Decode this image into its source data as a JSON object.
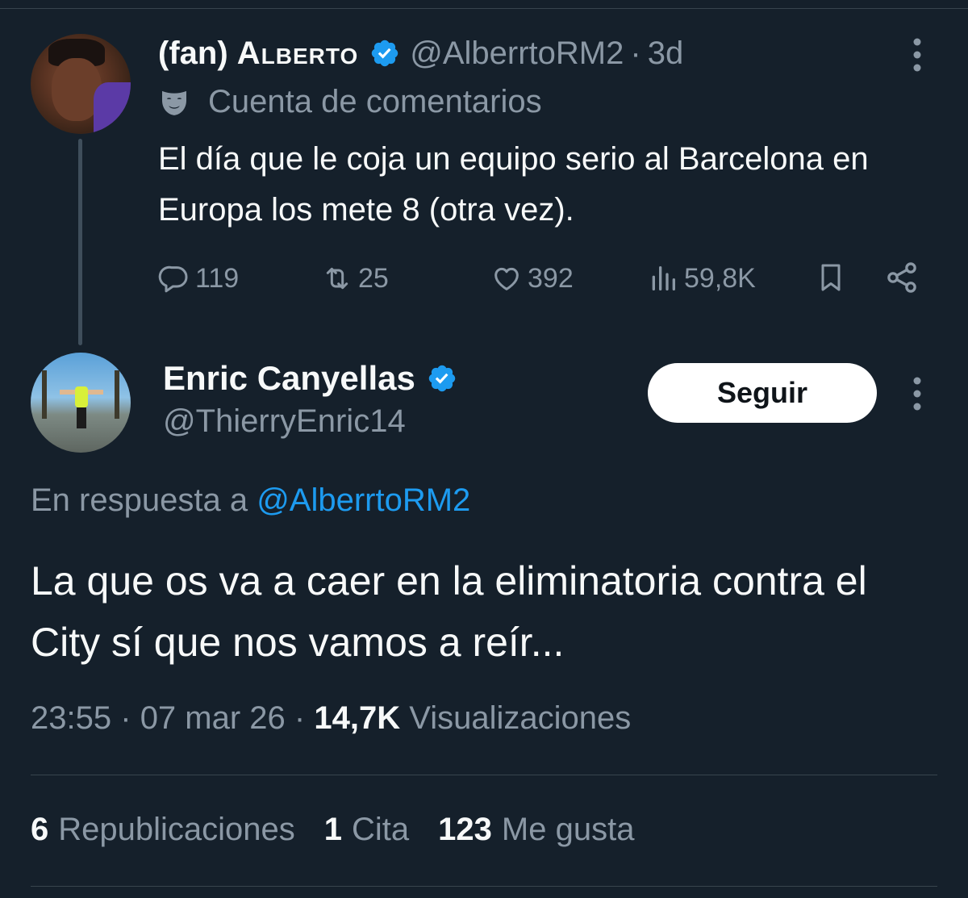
{
  "parent_tweet": {
    "display_name_prefix": "(fan)",
    "display_name_main": "Alberto",
    "handle": "@AlberrtoRM2",
    "separator": "·",
    "time": "3d",
    "account_label": "Cuenta de comentarios",
    "text": "El día que le coja un equipo serio al Barcelona en Europa los mete 8 (otra vez).",
    "replies": "119",
    "reposts": "25",
    "likes": "392",
    "views": "59,8K",
    "icons": [
      "verified-badge-icon",
      "parody-mask-icon",
      "reply-icon",
      "repost-icon",
      "like-icon",
      "views-icon",
      "bookmark-icon",
      "share-icon",
      "more-options-icon"
    ]
  },
  "main_tweet": {
    "display_name": "Enric Canyellas",
    "handle": "@ThierryEnric14",
    "follow_label": "Seguir",
    "reply_prefix": "En respuesta a",
    "reply_handle": "@AlberrtoRM2",
    "text": "La que os va a caer en la eliminatoria contra el City sí que nos vamos a reír...",
    "time": "23:55",
    "date": "07 mar 26",
    "separator": "·",
    "views_count": "14,7K",
    "views_label": "Visualizaciones",
    "stats": [
      {
        "count": "6",
        "label": "Republicaciones"
      },
      {
        "count": "1",
        "label": "Cita"
      },
      {
        "count": "123",
        "label": "Me gusta"
      }
    ]
  },
  "colors": {
    "background": "#15202b",
    "text_primary": "#f7f9f9",
    "text_secondary": "#8b98a5",
    "accent": "#1d9bf0",
    "border": "#38444d"
  }
}
